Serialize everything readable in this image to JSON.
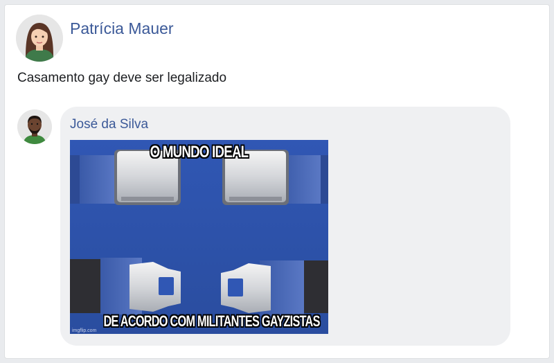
{
  "post": {
    "author": "Patrícia Mauer",
    "text": "Casamento gay deve ser legalizado",
    "avatar_icon": "woman-avatar-icon"
  },
  "comment": {
    "author": "José da Silva",
    "avatar_icon": "man-avatar-icon",
    "meme": {
      "top_caption": "O MUNDO IDEAL",
      "bottom_caption": "DE ACORDO COM MILITANTES GAYZISTAS",
      "watermark": "imgflip.com"
    }
  },
  "colors": {
    "name_link": "#3b5998",
    "bubble": "#eff0f2",
    "meme_background": "#2f52a8"
  }
}
